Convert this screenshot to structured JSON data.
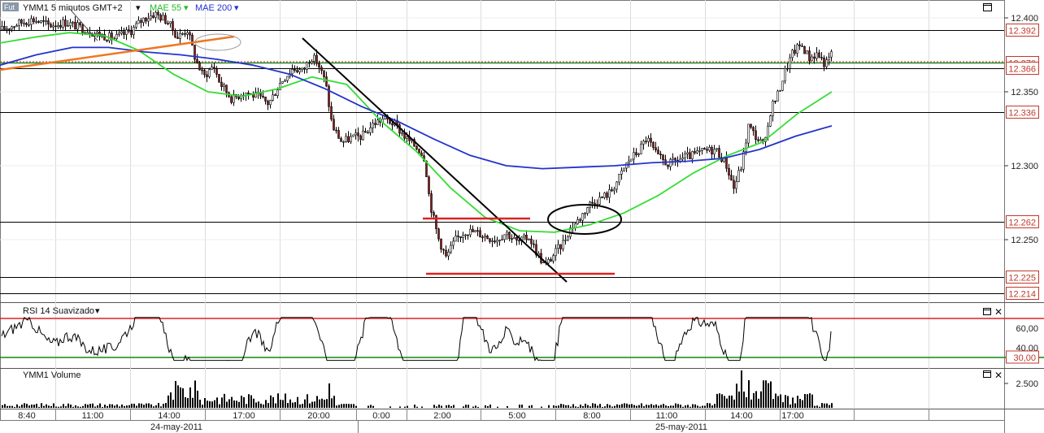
{
  "main_chart": {
    "symbol_label": "YMM1 5 minutos GMT+2",
    "ind1_label": "MAE 55",
    "ind2_label": "MAE 200",
    "fut_badge": "Fut",
    "colors": {
      "up": "#ffffff",
      "down": "#8b1a1a",
      "ma55": "#33dd33",
      "ma200": "#2233cc",
      "trend_black": "#000000",
      "trend_orange": "#ee7722",
      "support_red": "#dd2222",
      "dotted": "#cc3333"
    }
  },
  "chart_data": [
    {
      "type": "candlestick",
      "title": "YMM1 5 minutos GMT+2",
      "series": [
        {
          "name": "MAE 55",
          "values": [
            12.383,
            12.387,
            12.39,
            12.388,
            12.378,
            12.362,
            12.35,
            12.347,
            12.352,
            12.36,
            12.355,
            12.33,
            12.31,
            12.285,
            12.265,
            12.256,
            12.255,
            12.26,
            12.268,
            12.28,
            12.295,
            12.307,
            12.316,
            12.335,
            12.35
          ]
        },
        {
          "name": "MAE 200",
          "values": [
            12.368,
            12.375,
            12.38,
            12.38,
            12.377,
            12.375,
            12.372,
            12.368,
            12.362,
            12.352,
            12.34,
            12.33,
            12.318,
            12.307,
            12.3,
            12.298,
            12.299,
            12.3,
            12.302,
            12.303,
            12.305,
            12.311,
            12.32,
            12.327
          ]
        }
      ],
      "x_ticks": [
        "8:40",
        "11:00",
        "14:00",
        "17:00",
        "20:00",
        "0:00",
        "2:00",
        "5:00",
        "8:00",
        "11:00",
        "14:00",
        "17:00"
      ],
      "date_labels": [
        "24-may-2011",
        "25-may-2011"
      ],
      "y_ticks": [
        "12.400",
        "12.350",
        "12.300",
        "12.250"
      ],
      "ylim": [
        12.205,
        12.42
      ],
      "horizontal_levels": [
        {
          "value": 12.392,
          "label": "12.392"
        },
        {
          "value": 12.37,
          "label": "12.370"
        },
        {
          "value": 12.366,
          "label": "12.366"
        },
        {
          "value": 12.336,
          "label": "12.336"
        },
        {
          "value": 12.262,
          "label": "12.262"
        },
        {
          "value": 12.225,
          "label": "12.225"
        },
        {
          "value": 12.214,
          "label": "12.214"
        }
      ],
      "grid": true
    },
    {
      "type": "line",
      "title": "RSI 14 Suavizado",
      "y_ticks": [
        "60,00",
        "40,00"
      ],
      "levels": [
        {
          "value": 70,
          "label": ""
        },
        {
          "value": 30,
          "label": "30,00"
        }
      ],
      "ylim": [
        25,
        75
      ]
    },
    {
      "type": "bar",
      "title": "YMM1 Volume",
      "y_ticks": [
        "2.500"
      ]
    }
  ]
}
